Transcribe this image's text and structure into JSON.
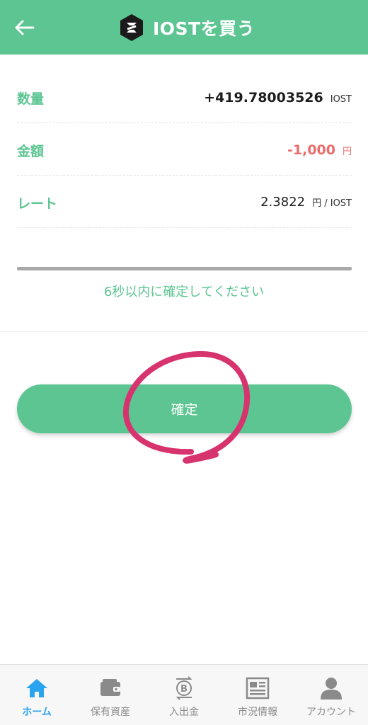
{
  "header": {
    "title": "IOSTを買う",
    "back_icon": "arrow-left-icon",
    "logo_icon": "iost-logo-icon"
  },
  "rows": [
    {
      "label": "数量",
      "value": "+419.78003526",
      "unit": "IOST"
    },
    {
      "label": "金額",
      "value": "-1,000",
      "unit": "円"
    },
    {
      "label": "レート",
      "value": "2.3822",
      "unit": "円 / IOST"
    }
  ],
  "countdown": "6秒以内に確定してください",
  "confirm_button": "確定",
  "bottom_nav": [
    {
      "label": "ホーム",
      "icon": "home-icon",
      "active": true
    },
    {
      "label": "保有資産",
      "icon": "wallet-icon",
      "active": false
    },
    {
      "label": "入出金",
      "icon": "bitcoin-transfer-icon",
      "active": false
    },
    {
      "label": "市況情報",
      "icon": "newspaper-icon",
      "active": false
    },
    {
      "label": "アカウント",
      "icon": "person-icon",
      "active": false
    }
  ],
  "colors": {
    "accent": "#5cc592",
    "negative": "#ec6c6c",
    "nav_active": "#2aa4ee",
    "annotation": "#d6336f"
  }
}
